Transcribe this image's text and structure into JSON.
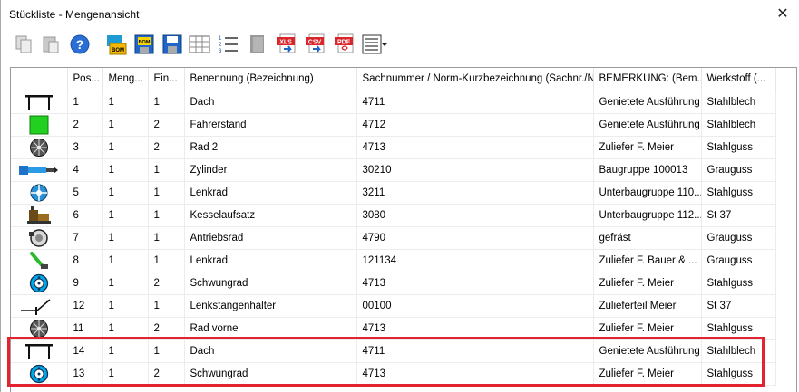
{
  "window": {
    "title": "Stückliste - Mengenansicht",
    "close_glyph": "✕"
  },
  "toolbar": [
    {
      "name": "copy-icon"
    },
    {
      "name": "paste-icon"
    },
    {
      "name": "help-icon"
    },
    {
      "name": "bom-import-icon",
      "label": "BOM"
    },
    {
      "name": "bom-export-icon",
      "label": "BOM"
    },
    {
      "name": "save-icon"
    },
    {
      "name": "table-view-icon"
    },
    {
      "name": "numbered-list-icon"
    },
    {
      "name": "grey-block-icon"
    },
    {
      "name": "xls-export-icon",
      "label": "XLS"
    },
    {
      "name": "csv-export-icon",
      "label": "CSV"
    },
    {
      "name": "pdf-export-icon",
      "label": "PDF"
    },
    {
      "name": "columns-menu-icon"
    }
  ],
  "table": {
    "columns": [
      "",
      "Pos...",
      "Meng...",
      "Ein...",
      "Benennung (Bezeichnung)",
      "Sachnummer / Norm-Kurzbezeichnung (Sachnr./N...",
      "BEMERKUNG: (Bem...",
      "Werkstoff (..."
    ],
    "rows": [
      {
        "icon": "roof",
        "pos": "1",
        "menge": "1",
        "ein": "1",
        "benennung": "Dach",
        "sachnummer": "4711",
        "bemerkung": "Genietete Ausführung",
        "werkstoff": "Stahlblech"
      },
      {
        "icon": "green",
        "pos": "2",
        "menge": "1",
        "ein": "2",
        "benennung": "Fahrerstand",
        "sachnummer": "4712",
        "bemerkung": "Genietete Ausführung",
        "werkstoff": "Stahlblech"
      },
      {
        "icon": "wheel",
        "pos": "3",
        "menge": "1",
        "ein": "2",
        "benennung": "Rad 2",
        "sachnummer": "4713",
        "bemerkung": "Zuliefer F. Meier",
        "werkstoff": "Stahlguss"
      },
      {
        "icon": "cylinder",
        "pos": "4",
        "menge": "1",
        "ein": "1",
        "benennung": "Zylinder",
        "sachnummer": "30210",
        "bemerkung": "Baugruppe 100013",
        "werkstoff": "Grauguss"
      },
      {
        "icon": "steer",
        "pos": "5",
        "menge": "1",
        "ein": "1",
        "benennung": "Lenkrad",
        "sachnummer": "3211",
        "bemerkung": "Unterbaugruppe 110...",
        "werkstoff": "Stahlguss"
      },
      {
        "icon": "boiler",
        "pos": "6",
        "menge": "1",
        "ein": "1",
        "benennung": "Kesselaufsatz",
        "sachnummer": "3080",
        "bemerkung": "Unterbaugruppe 112...",
        "werkstoff": "St 37"
      },
      {
        "icon": "drive",
        "pos": "7",
        "menge": "1",
        "ein": "1",
        "benennung": "Antriebsrad",
        "sachnummer": "4790",
        "bemerkung": "gefräst",
        "werkstoff": "Grauguss"
      },
      {
        "icon": "lever",
        "pos": "8",
        "menge": "1",
        "ein": "1",
        "benennung": "Lenkrad",
        "sachnummer": "121134",
        "bemerkung": "Zuliefer F. Bauer  & ...",
        "werkstoff": "Grauguss"
      },
      {
        "icon": "flywheel",
        "pos": "9",
        "menge": "1",
        "ein": "2",
        "benennung": "Schwungrad",
        "sachnummer": "4713",
        "bemerkung": "Zuliefer F. Meier",
        "werkstoff": "Stahlguss"
      },
      {
        "icon": "holder",
        "pos": "12",
        "menge": "1",
        "ein": "1",
        "benennung": "Lenkstangenhalter",
        "sachnummer": "00100",
        "bemerkung": "Zulieferteil Meier",
        "werkstoff": "St 37"
      },
      {
        "icon": "wheel",
        "pos": "11",
        "menge": "1",
        "ein": "2",
        "benennung": "Rad vorne",
        "sachnummer": "4713",
        "bemerkung": "Zuliefer F. Meier",
        "werkstoff": "Stahlguss"
      },
      {
        "icon": "roof",
        "pos": "14",
        "menge": "1",
        "ein": "1",
        "benennung": "Dach",
        "sachnummer": "4711",
        "bemerkung": "Genietete Ausführung",
        "werkstoff": "Stahlblech"
      },
      {
        "icon": "flywheel",
        "pos": "13",
        "menge": "1",
        "ein": "2",
        "benennung": "Schwungrad",
        "sachnummer": "4713",
        "bemerkung": "Zuliefer F. Meier",
        "werkstoff": "Stahlguss"
      }
    ]
  },
  "colors": {
    "highlight": "#e3232f",
    "green_part": "#22d11f",
    "flywheel": "#00a6e6"
  }
}
